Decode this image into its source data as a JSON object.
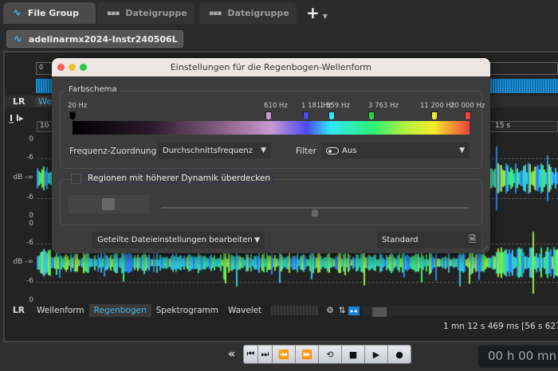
{
  "tabs": [
    {
      "label": "File Group",
      "icon": "waveform-icon",
      "active": true
    },
    {
      "label": "Dateigruppe",
      "icon": "group-icon"
    },
    {
      "label": "Dateigruppe",
      "icon": "group-icon"
    }
  ],
  "add_tab": "+",
  "file_tab": {
    "label": "adelinarmx2024-Instr240506L"
  },
  "overview": {
    "start": "0",
    "lr": "LR",
    "view_partial": "Well"
  },
  "ruler": {
    "left": "10 s",
    "right": "15 s"
  },
  "axis": {
    "ch1": [
      "0",
      "-6",
      "dB -∞",
      "-6",
      "0"
    ],
    "ch2": [
      "0",
      "-6",
      "dB -∞",
      "-6",
      "0"
    ]
  },
  "dialog": {
    "title": "Einstellungen für die Regenbogen-Wellenform",
    "group_title": "Farbschema",
    "markers": [
      {
        "label": "20 Hz",
        "color": "#000000"
      },
      {
        "label": "610 Hz",
        "color": "#c99ad0"
      },
      {
        "label": "1 181 Hz",
        "color": "#4a4cf0"
      },
      {
        "label": "1 859 Hz",
        "color": "#30e8f5"
      },
      {
        "label": "3 763 Hz",
        "color": "#2ed14a"
      },
      {
        "label": "11 200 Hz",
        "color": "#f3ec2a"
      },
      {
        "label": "20 000 Hz",
        "color": "#f04040"
      }
    ],
    "freq_label": "Frequenz-Zuordnung",
    "freq_value": "Durchschnittsfrequenz",
    "filter_label": "Filter",
    "filter_value": "Aus",
    "checkbox_label": "Regionen mit höherer Dynamik überdecken",
    "checkbox_checked": false,
    "shared_settings": "Geteilte Dateieinstellungen bearbeiten",
    "preset": "Standard"
  },
  "bottom_tabs": {
    "lr": "LR",
    "items": [
      "Wellenform",
      "Regenbogen",
      "Spektrogramm",
      "Wavelet"
    ],
    "active": "Regenbogen"
  },
  "status": "1 mn 12 s 469 ms [56 s 627",
  "transport": {
    "collapse": "«",
    "time": "00 h 00 mn"
  },
  "colors": {
    "accent": "#49b3e8",
    "overview_wave": "#1a8fd6"
  }
}
